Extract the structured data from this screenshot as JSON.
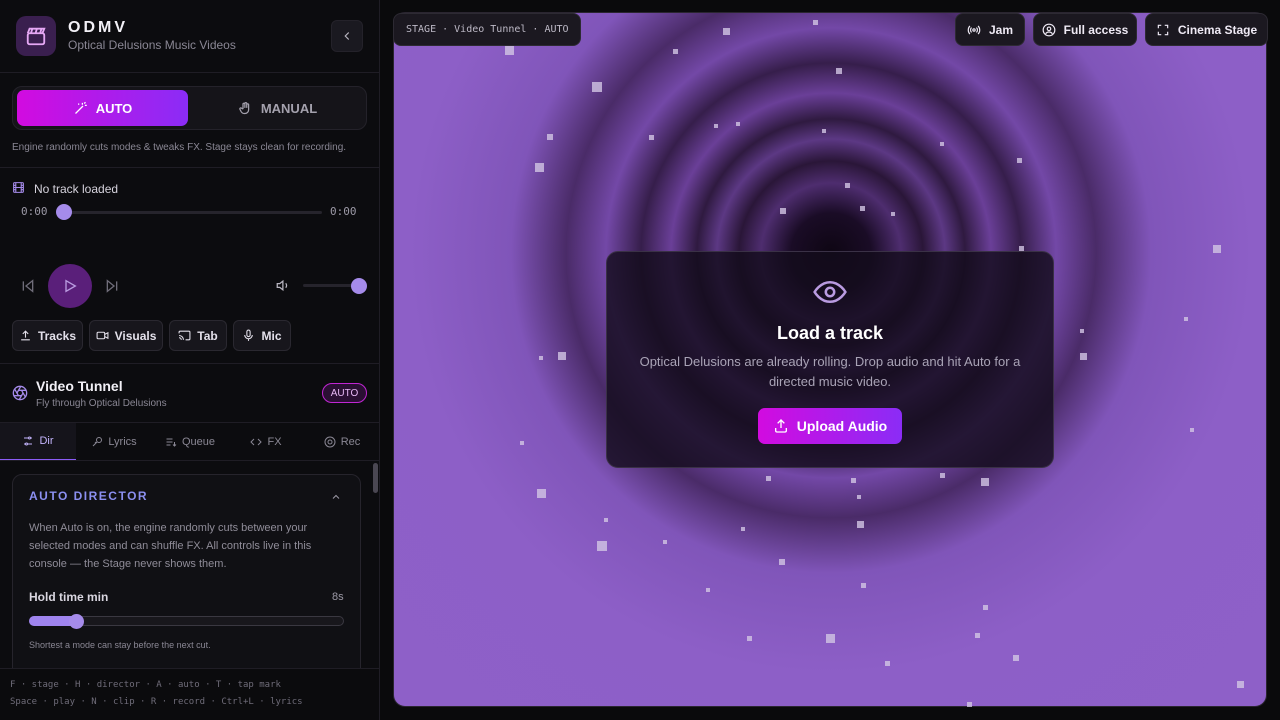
{
  "app": {
    "name": "ODMV",
    "subtitle": "Optical Delusions Music Videos"
  },
  "mode_toggle": {
    "auto_label": "AUTO",
    "manual_label": "MANUAL",
    "selected": "AUTO",
    "help": "Engine randomly cuts modes & tweaks FX. Stage stays clean for recording."
  },
  "player": {
    "track": "No track loaded",
    "time_current": "0:00",
    "time_total": "0:00",
    "progress": 0,
    "volume": 1
  },
  "sources": {
    "tracks": "Tracks",
    "visuals": "Visuals",
    "tab": "Tab",
    "mic": "Mic"
  },
  "visual_mode": {
    "name": "Video Tunnel",
    "description": "Fly through Optical Delusions",
    "badge": "AUTO"
  },
  "tabs": [
    {
      "label": "Dir",
      "icon": "sliders-icon",
      "active": true
    },
    {
      "label": "Lyrics",
      "icon": "mic-icon",
      "active": false
    },
    {
      "label": "Queue",
      "icon": "queue-icon",
      "active": false
    },
    {
      "label": "FX",
      "icon": "code-icon",
      "active": false
    },
    {
      "label": "Rec",
      "icon": "record-icon",
      "active": false
    }
  ],
  "director": {
    "title": "AUTO DIRECTOR",
    "description": "When Auto is on, the engine randomly cuts between your selected modes and can shuffle FX. All controls live in this console — the Stage never shows them.",
    "hold_label": "Hold time min",
    "hold_value": "8s",
    "hold_fraction": 0.15,
    "hold_help": "Shortest a mode can stay before the next cut."
  },
  "shortcuts": {
    "line1": "F · stage · H · director · A · auto · T · tap mark",
    "line2": "Space · play · N · clip · R · record · Ctrl+L · lyrics"
  },
  "stage": {
    "label": "STAGE · Video Tunnel · AUTO",
    "jam": "Jam",
    "full_access": "Full access",
    "cinema": "Cinema Stage"
  },
  "load_prompt": {
    "title": "Load a track",
    "text": "Optical Delusions are already rolling. Drop audio and hit Auto for a directed music video.",
    "button": "Upload Audio"
  },
  "colors": {
    "accent_start": "#d20be0",
    "accent_end": "#8b2cf6",
    "lavender": "#a58bea",
    "stage_purple": "#8e60c9"
  }
}
